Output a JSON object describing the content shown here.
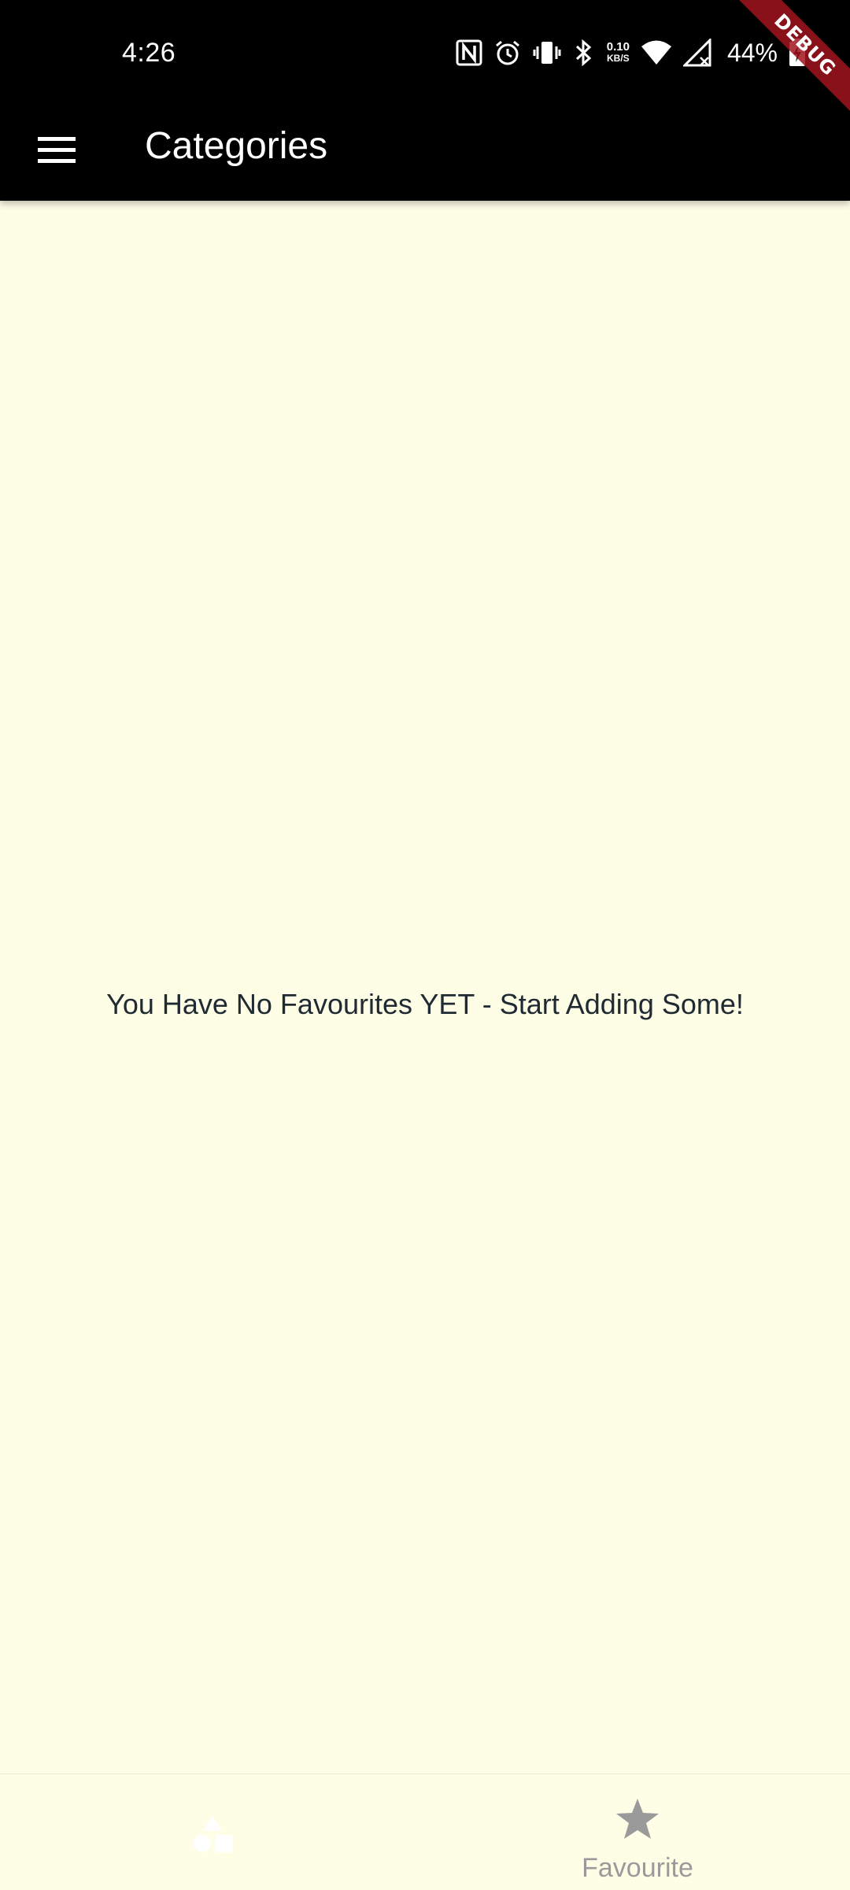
{
  "status_bar": {
    "time": "4:26",
    "net_speed_value": "0.10",
    "net_speed_unit": "KB/S",
    "battery_percent": "44%",
    "icons": [
      "nfc-icon",
      "alarm-icon",
      "vibrate-icon",
      "bluetooth-icon",
      "wifi-icon",
      "signal-icon",
      "battery-charging-icon"
    ]
  },
  "debug_banner": {
    "label": "DEBUG"
  },
  "app_bar": {
    "menu_icon": "menu-icon",
    "title": "Categories"
  },
  "main": {
    "empty_message": "You Have No Favourites YET - Start Adding Some!"
  },
  "bottom_nav": {
    "items": [
      {
        "icon": "categories-icon",
        "label": "",
        "selected": false
      },
      {
        "icon": "star-icon",
        "label": "Favourite",
        "selected": true
      }
    ]
  },
  "colors": {
    "background": "#fefde6",
    "app_bar": "#000000",
    "text": "#1f2a33",
    "nav_label": "#9a9a9a"
  }
}
